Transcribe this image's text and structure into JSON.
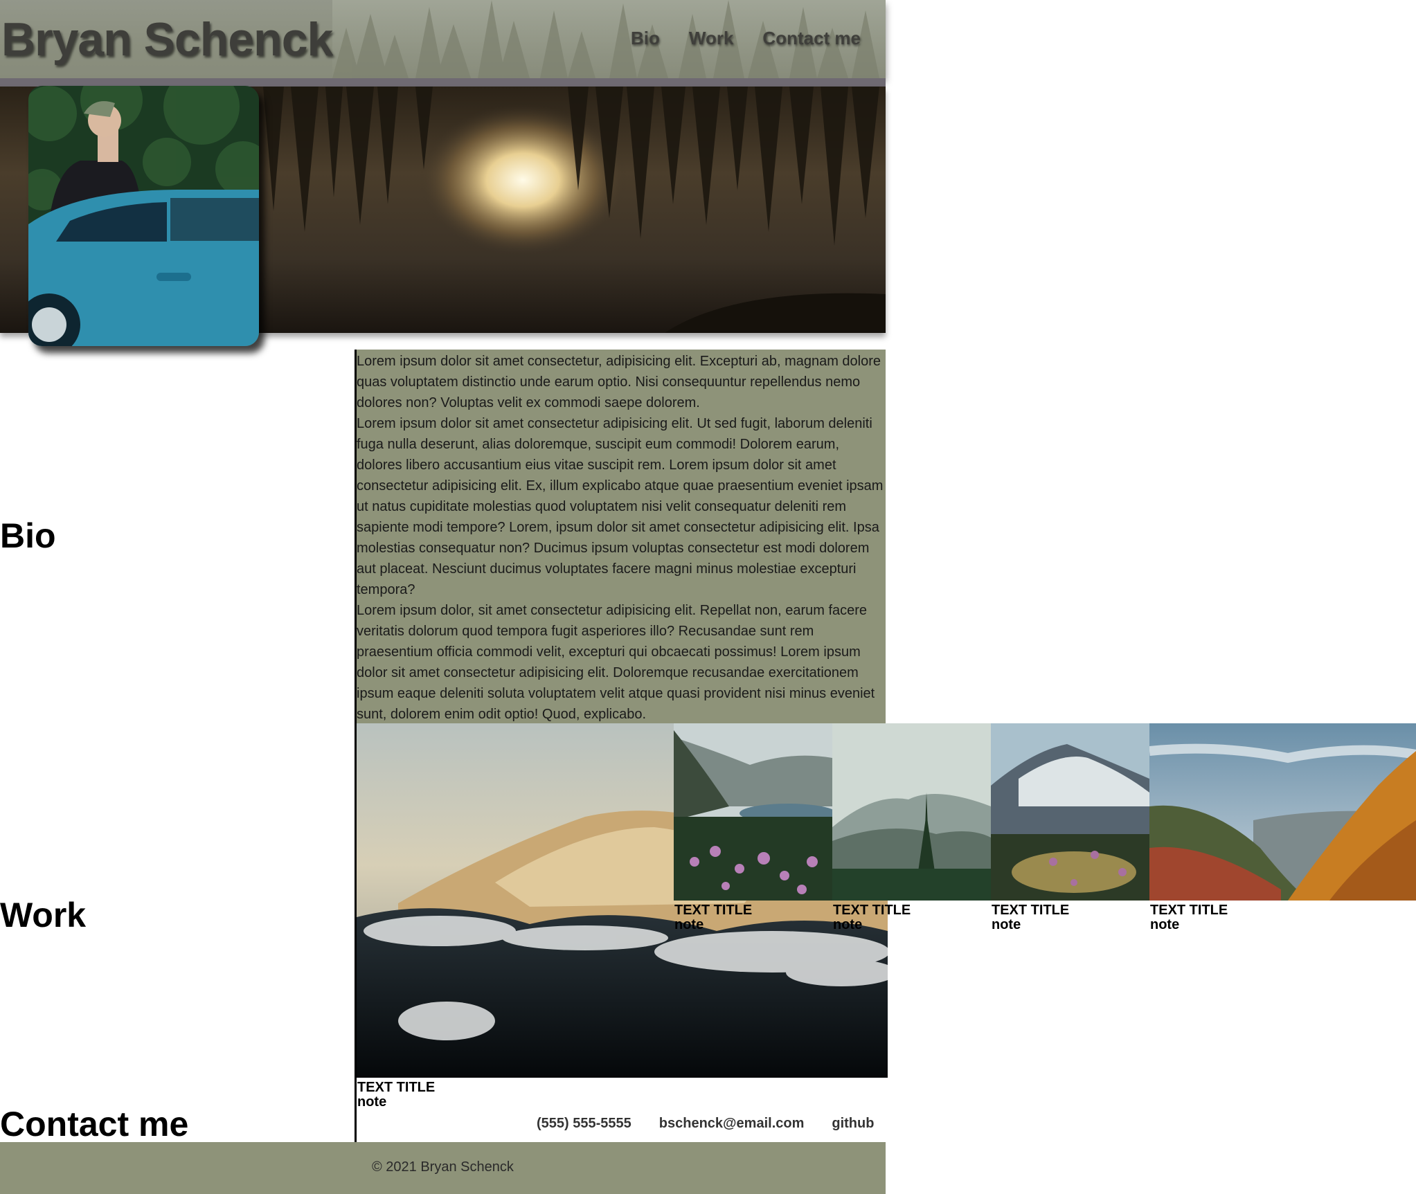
{
  "header": {
    "title": "Bryan Schenck",
    "nav": [
      "Bio",
      "Work",
      "Contact me"
    ]
  },
  "sections": {
    "bio": "Bio",
    "work": "Work",
    "contact": "Contact me"
  },
  "bio": {
    "paragraphs": [
      "Lorem ipsum dolor sit amet consectetur, adipisicing elit. Excepturi ab, magnam dolore quas voluptatem distinctio unde earum optio. Nisi consequuntur repellendus nemo dolores non? Voluptas velit ex commodi saepe dolorem.",
      "Lorem ipsum dolor sit amet consectetur adipisicing elit. Ut sed fugit, laborum deleniti fuga nulla deserunt, alias doloremque, suscipit eum commodi! Dolorem earum, dolores libero accusantium eius vitae suscipit rem. Lorem ipsum dolor sit amet consectetur adipisicing elit. Ex, illum explicabo atque quae praesentium eveniet ipsam ut natus cupiditate molestias quod voluptatem nisi velit consequatur deleniti rem sapiente modi tempore? Lorem, ipsum dolor sit amet consectetur adipisicing elit. Ipsa molestias consequatur non? Ducimus ipsum voluptas consectetur est modi dolorem aut placeat. Nesciunt ducimus voluptates facere magni minus molestiae excepturi tempora?",
      "Lorem ipsum dolor, sit amet consectetur adipisicing elit. Repellat non, earum facere veritatis dolorum quod tempora fugit asperiores illo? Recusandae sunt rem praesentium officia commodi velit, excepturi qui obcaecati possimus! Lorem ipsum dolor sit amet consectetur adipisicing elit. Doloremque recusandae exercitationem ipsum eaque deleniti soluta voluptatem velit atque quasi provident nisi minus eveniet sunt, dolorem enim odit optio! Quod, explicabo."
    ]
  },
  "work": {
    "items": [
      {
        "title": "TEXT TITLE",
        "note": "note"
      },
      {
        "title": "TEXT TITLE",
        "note": "note"
      },
      {
        "title": "TEXT TITLE",
        "note": "note"
      },
      {
        "title": "TEXT TITLE",
        "note": "note"
      },
      {
        "title": "TEXT TITLE",
        "note": "note"
      }
    ]
  },
  "contact": {
    "phone": "(555) 555-5555",
    "email": "bschenck@email.com",
    "github": "github"
  },
  "footer": {
    "copyright": "© 2021 Bryan Schenck"
  },
  "colors": {
    "header": "#8b8f7e",
    "accent_strip": "#6f6a72",
    "panel": "#8e9379"
  }
}
